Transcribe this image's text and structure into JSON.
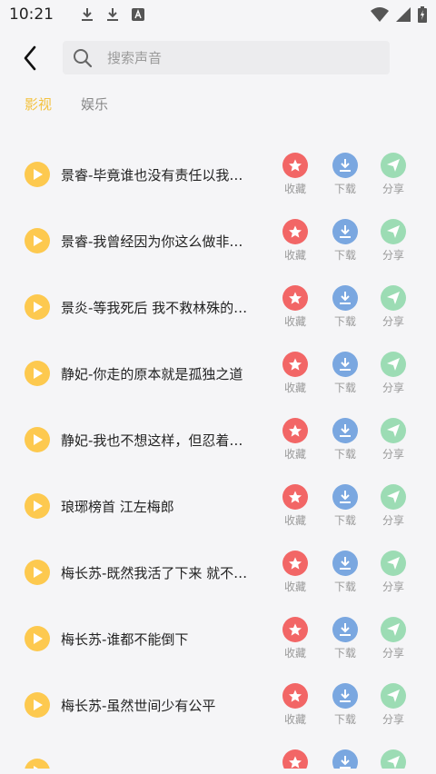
{
  "status_bar": {
    "time": "10:21"
  },
  "search": {
    "placeholder": "搜索声音"
  },
  "tabs": [
    {
      "label": "影视",
      "active": true
    },
    {
      "label": "娱乐",
      "active": false
    }
  ],
  "actions": {
    "favorite": "收藏",
    "download": "下载",
    "share": "分享"
  },
  "colors": {
    "accent": "#f4c240",
    "play": "#fdc94f",
    "favorite": "#f26666",
    "download": "#7aa7e0",
    "share": "#9cdcb4"
  },
  "items": [
    {
      "title": "景睿-毕竟谁也没有责任以我…"
    },
    {
      "title": "景睿-我曾经因为你这么做非…"
    },
    {
      "title": "景炎-等我死后 我不救林殊的…"
    },
    {
      "title": "静妃-你走的原本就是孤独之道"
    },
    {
      "title": "静妃-我也不想这样，但忍着…"
    },
    {
      "title": "琅琊榜首 江左梅郎"
    },
    {
      "title": "梅长苏-既然我活了下来 就不…"
    },
    {
      "title": "梅长苏-谁都不能倒下"
    },
    {
      "title": "梅长苏-虽然世间少有公平"
    },
    {
      "title": ""
    }
  ]
}
